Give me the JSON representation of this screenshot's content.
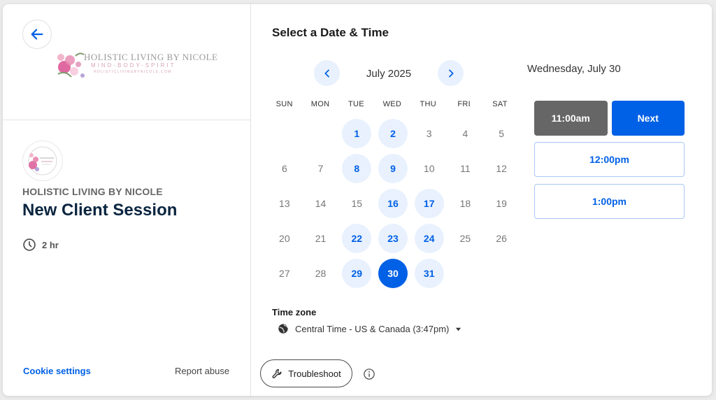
{
  "brand": {
    "logo_title": "HOLISTIC LIVING BY NICOLE",
    "logo_tagline": "MIND-BODY-SPIRIT",
    "logo_url": "HOLISTICLIVINGBYNICOLE.COM"
  },
  "event": {
    "organizer": "HOLISTIC LIVING BY NICOLE",
    "name": "New Client Session",
    "duration": "2 hr",
    "duration_icon": "clock-icon"
  },
  "footer": {
    "cookie_settings": "Cookie settings",
    "report_abuse": "Report abuse"
  },
  "calendar": {
    "title": "Select a Date & Time",
    "month": "July 2025",
    "weekdays": [
      "SUN",
      "MON",
      "TUE",
      "WED",
      "THU",
      "FRI",
      "SAT"
    ],
    "first_weekday_index": 2,
    "days_in_month": 31,
    "available_days": [
      1,
      2,
      8,
      9,
      16,
      17,
      22,
      23,
      24,
      29,
      31
    ],
    "selected_day": 30,
    "timezone_label": "Time zone",
    "timezone_value": "Central Time - US & Canada (3:47pm)"
  },
  "slots": {
    "date_heading": "Wednesday, July 30",
    "picked_time": "11:00am",
    "next_label": "Next",
    "times": [
      "12:00pm",
      "1:00pm"
    ]
  },
  "tools": {
    "troubleshoot_label": "Troubleshoot"
  },
  "colors": {
    "accent": "#0060e6",
    "available_bg": "#e8f1fd",
    "picked_slot": "#666666"
  }
}
